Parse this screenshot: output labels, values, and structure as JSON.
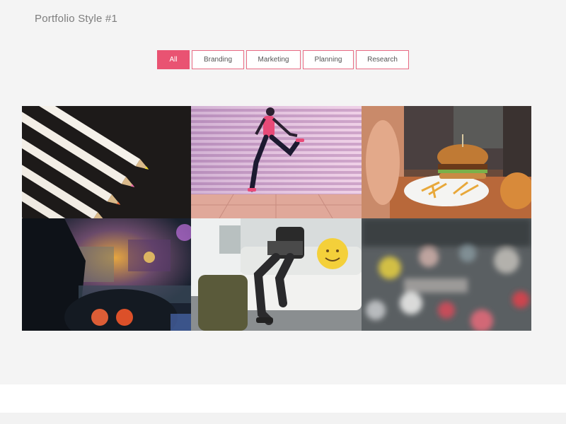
{
  "page": {
    "title": "Portfolio Style #1"
  },
  "filters": {
    "items": [
      {
        "label": "All",
        "active": true
      },
      {
        "label": "Branding",
        "active": false
      },
      {
        "label": "Marketing",
        "active": false
      },
      {
        "label": "Planning",
        "active": false
      },
      {
        "label": "Research",
        "active": false
      }
    ]
  },
  "portfolio": {
    "items": [
      {
        "subject": "colored-pencils"
      },
      {
        "subject": "runner-jumping"
      },
      {
        "subject": "burger-and-fries"
      },
      {
        "subject": "night-driving"
      },
      {
        "subject": "man-on-sofa"
      },
      {
        "subject": "rainy-window-bokeh"
      }
    ]
  },
  "colors": {
    "accent": "#e95372",
    "background": "#f4f4f4",
    "title_text": "#7d7d7d"
  }
}
